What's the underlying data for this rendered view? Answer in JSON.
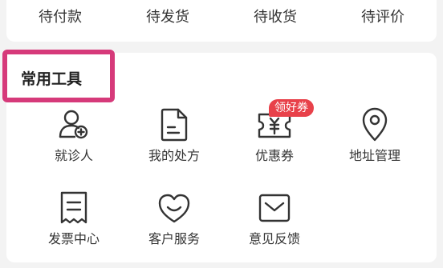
{
  "order_status": {
    "items": [
      {
        "label": "待付款"
      },
      {
        "label": "待发货"
      },
      {
        "label": "待收货"
      },
      {
        "label": "待评价"
      }
    ]
  },
  "tools": {
    "title": "常用工具",
    "items": [
      {
        "label": "就诊人",
        "icon": "patient-icon"
      },
      {
        "label": "我的处方",
        "icon": "prescription-icon"
      },
      {
        "label": "优惠券",
        "icon": "coupon-icon",
        "badge": "领好券"
      },
      {
        "label": "地址管理",
        "icon": "location-pin-icon"
      },
      {
        "label": "发票中心",
        "icon": "invoice-icon"
      },
      {
        "label": "客户服务",
        "icon": "customer-service-icon"
      },
      {
        "label": "意见反馈",
        "icon": "feedback-mail-icon"
      }
    ]
  },
  "colors": {
    "badge": "#e8414a",
    "highlight_border": "#d63a7a",
    "icon_stroke": "#333333"
  }
}
